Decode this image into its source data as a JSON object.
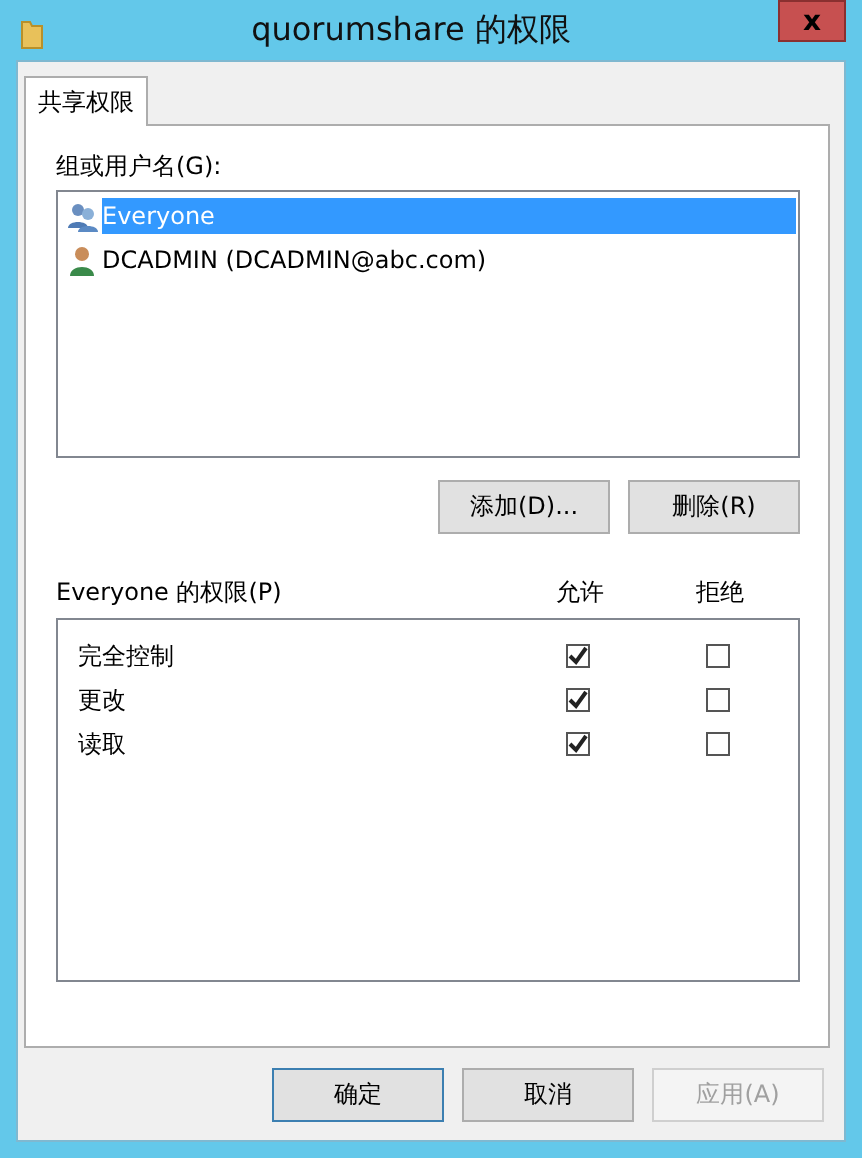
{
  "window": {
    "title": "quorumshare 的权限",
    "close": "x"
  },
  "tabs": [
    {
      "label": "共享权限",
      "selected": true
    }
  ],
  "users_label": "组或用户名(G):",
  "users": [
    {
      "name": "Everyone",
      "kind": "group",
      "selected": true
    },
    {
      "name": "DCADMIN (DCADMIN@abc.com)",
      "kind": "user",
      "selected": false
    }
  ],
  "user_buttons": [
    {
      "label": "添加(D)...",
      "disabled": false
    },
    {
      "label": "删除(R)",
      "disabled": false
    }
  ],
  "permissions_label": "Everyone 的权限(P)",
  "columns": [
    "允许",
    "拒绝"
  ],
  "permissions": [
    {
      "name": "完全控制",
      "allow": true,
      "deny": false
    },
    {
      "name": "更改",
      "allow": true,
      "deny": false
    },
    {
      "name": "读取",
      "allow": true,
      "deny": false
    }
  ],
  "buttons": [
    {
      "label": "确定",
      "default": true,
      "disabled": false
    },
    {
      "label": "取消",
      "default": false,
      "disabled": false
    },
    {
      "label": "应用(A)",
      "default": false,
      "disabled": true
    }
  ]
}
